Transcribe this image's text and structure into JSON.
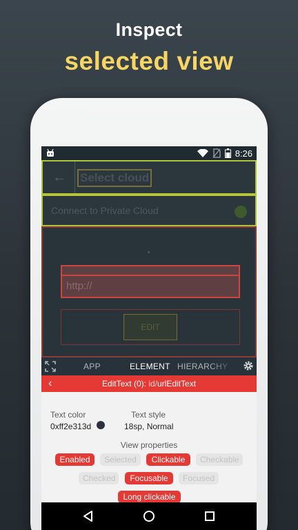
{
  "promo": {
    "line1": "Inspect",
    "line2": "selected view"
  },
  "status_bar": {
    "time": "8:26",
    "icons": [
      "android-robot-icon",
      "wifi-icon",
      "no-sim-icon",
      "battery-icon"
    ]
  },
  "inspected_app": {
    "title": "Select cloud",
    "connect_label": "Connect to Private Cloud",
    "url_placeholder": "http://",
    "edit_button": "EDIT"
  },
  "inspector": {
    "tabs": [
      {
        "label": "APP",
        "active": false
      },
      {
        "label": "ELEMENT",
        "active": true
      },
      {
        "label": "HIERARCHY",
        "active": false
      }
    ],
    "element_title": "EditText (0): ",
    "element_id_prefix": "id/",
    "element_id": "urlEditText",
    "text_color_label": "Text color",
    "text_color_value": "0xff2e313d",
    "text_style_label": "Text style",
    "text_style_value": "18sp, Normal",
    "view_properties_label": "View properties",
    "chips": [
      {
        "label": "Enabled",
        "active": true
      },
      {
        "label": "Selected",
        "active": false
      },
      {
        "label": "Clickable",
        "active": true
      },
      {
        "label": "Checkable",
        "active": false
      },
      {
        "label": "Checked",
        "active": false
      },
      {
        "label": "Focusable",
        "active": true
      },
      {
        "label": "Focused",
        "active": false
      },
      {
        "label": "Long clickable",
        "active": true
      }
    ]
  },
  "colors": {
    "accent_red": "#e53935",
    "highlight_yellow": "#f7d564",
    "layout_green": "#b6c43a",
    "text_color_swatch": "#2e313d"
  }
}
